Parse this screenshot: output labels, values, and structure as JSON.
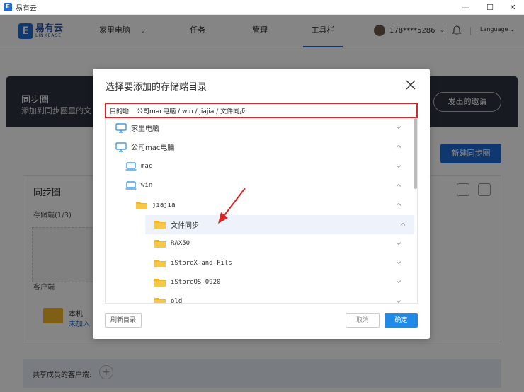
{
  "window": {
    "title": "易有云"
  },
  "logo": {
    "cn": "易有云",
    "en": "LINKEASE"
  },
  "nav": {
    "items": [
      {
        "label": "家里电脑"
      },
      {
        "label": "任务"
      },
      {
        "label": "管理"
      },
      {
        "label": "工具栏"
      }
    ],
    "active": "工具栏"
  },
  "user": {
    "name": "178****5286"
  },
  "language": {
    "label": "Language"
  },
  "background": {
    "banner_title": "同步圈",
    "banner_subtitle": "添加到同步圈里的文",
    "invite_label": "发出的邀请",
    "new_circle_label": "新建同步圈",
    "panel_title": "同步圈",
    "storage_label": "存储端(1/3)",
    "client_label": "客户端",
    "local_label": "本机",
    "local_status": "未加入",
    "shared_label": "共享成员的客户端:"
  },
  "dialog": {
    "title": "选择要添加的存储端目录",
    "destination": {
      "label": "目的地:",
      "path": "公司mac电脑 / win / jiajia / 文件同步"
    },
    "tree": [
      {
        "label": "家里电脑",
        "icon": "desktop-icon",
        "depth": 0,
        "expanded": false
      },
      {
        "label": "公司mac电脑",
        "icon": "desktop-icon",
        "depth": 0,
        "expanded": true
      },
      {
        "label": "mac",
        "icon": "laptop-icon",
        "depth": 1,
        "expanded": false
      },
      {
        "label": "win",
        "icon": "laptop-icon",
        "depth": 1,
        "expanded": true
      },
      {
        "label": "jiajia",
        "icon": "folder-icon",
        "depth": 2,
        "expanded": true
      },
      {
        "label": "文件同步",
        "icon": "folder-icon",
        "depth": 3,
        "expanded": true,
        "selected": true
      },
      {
        "label": "RAX50",
        "icon": "folder-icon",
        "depth": 3,
        "expanded": false
      },
      {
        "label": "iStoreX-and-Fils",
        "icon": "folder-icon",
        "depth": 3,
        "expanded": false
      },
      {
        "label": "iStoreOS-0920",
        "icon": "folder-icon",
        "depth": 3,
        "expanded": false
      },
      {
        "label": "old",
        "icon": "folder-icon",
        "depth": 3,
        "expanded": false
      }
    ],
    "refresh_label": "刷新目录",
    "cancel_label": "取消",
    "ok_label": "确定"
  },
  "colors": {
    "accent": "#1f8ae8",
    "highlight": "#e02424",
    "folder": "#f2b626"
  }
}
